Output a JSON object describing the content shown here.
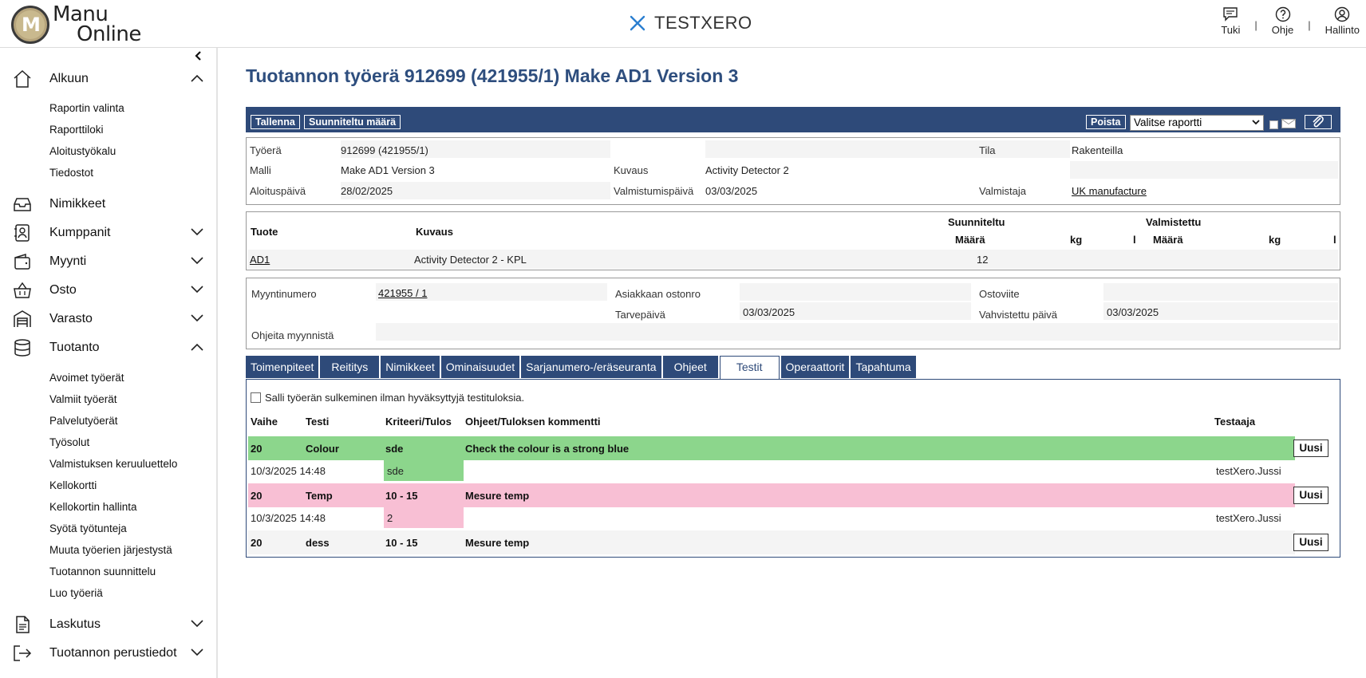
{
  "header": {
    "logo_line1": "Manu",
    "logo_line2": "Online",
    "brand": "TESTXERO",
    "actions": [
      {
        "label": "Tuki",
        "icon": "chat-icon"
      },
      {
        "label": "Ohje",
        "icon": "help-icon"
      },
      {
        "label": "Hallinto",
        "icon": "user-icon"
      }
    ],
    "separator": "|"
  },
  "sidebar": {
    "collapse_glyph": "‹",
    "sections": [
      {
        "label": "Alkuun",
        "icon": "home-icon",
        "expanded": true,
        "items": [
          "Raportin valinta",
          "Raporttiloki",
          "Aloitustyökalu",
          "Tiedostot"
        ]
      },
      {
        "label": "Nimikkeet",
        "icon": "inbox-icon",
        "expanded": null,
        "items": []
      },
      {
        "label": "Kumppanit",
        "icon": "contacts-icon",
        "expanded": false,
        "items": []
      },
      {
        "label": "Myynti",
        "icon": "wallet-icon",
        "expanded": false,
        "items": []
      },
      {
        "label": "Osto",
        "icon": "basket-icon",
        "expanded": false,
        "items": []
      },
      {
        "label": "Varasto",
        "icon": "warehouse-icon",
        "expanded": false,
        "items": []
      },
      {
        "label": "Tuotanto",
        "icon": "database-icon",
        "expanded": true,
        "items": [
          "Avoimet työerät",
          "Valmiit työerät",
          "Palvelutyöerät",
          "Työsolut",
          "Valmistuksen keruuluettelo",
          "Kellokortti",
          "Kellokortin hallinta",
          "Syötä työtunteja",
          "Muuta työerien järjestystä",
          "Tuotannon suunnittelu",
          "Luo työeriä"
        ]
      },
      {
        "label": "Laskutus",
        "icon": "document-icon",
        "expanded": false,
        "items": []
      },
      {
        "label": "Tuotannon perustiedot",
        "icon": "exit-icon",
        "expanded": false,
        "items": []
      }
    ]
  },
  "page": {
    "title": "Tuotannon työerä 912699 (421955/1) Make AD1 Version 3"
  },
  "toolbar": {
    "save_label": "Tallenna",
    "planned_qty_label": "Suunniteltu määrä",
    "delete_label": "Poista",
    "report_select": "Valitse raportti"
  },
  "info": {
    "tyoera_label": "Työerä",
    "tyoera_value": "912699 (421955/1)",
    "tila_label": "Tila",
    "tila_value": "Rakenteilla",
    "malli_label": "Malli",
    "malli_value": "Make AD1 Version 3",
    "kuvaus_label": "Kuvaus",
    "kuvaus_value": "Activity Detector 2",
    "aloitus_label": "Aloituspäivä",
    "aloitus_value": "28/02/2025",
    "valmistumis_label": "Valmistumispäivä",
    "valmistumis_value": "03/03/2025",
    "valmistaja_label": "Valmistaja",
    "valmistaja_value": "UK manufacture"
  },
  "products": {
    "headers": {
      "tuote": "Tuote",
      "kuvaus": "Kuvaus",
      "planned": "Suunniteltu",
      "produced": "Valmistettu",
      "maara": "Määrä",
      "kg": "kg",
      "l": "l"
    },
    "rows": [
      {
        "tuote": "AD1",
        "kuvaus": "Activity Detector 2 - KPL",
        "planned_qty": "12"
      }
    ]
  },
  "sales": {
    "myyntinumero_label": "Myyntinumero",
    "myyntinumero_value": "421955 / 1",
    "asiakkaan_label": "Asiakkaan ostonro",
    "asiakkaan_value": "",
    "ostoviite_label": "Ostoviite",
    "ostoviite_value": "",
    "tarvepaiva_label": "Tarvepäivä",
    "tarvepaiva_value": "03/03/2025",
    "vahvistettu_label": "Vahvistettu päivä",
    "vahvistettu_value": "03/03/2025",
    "ohjeita_label": "Ohjeita myynnistä",
    "ohjeita_value": ""
  },
  "tabs": [
    {
      "label": "Toimenpiteet",
      "active": false
    },
    {
      "label": "Reititys",
      "active": false
    },
    {
      "label": "Nimikkeet",
      "active": false
    },
    {
      "label": "Ominaisuudet",
      "active": false
    },
    {
      "label": "Sarjanumero-/eräseuranta",
      "active": false
    },
    {
      "label": "Ohjeet",
      "active": false
    },
    {
      "label": "Testit",
      "active": true
    },
    {
      "label": "Operaattorit",
      "active": false
    },
    {
      "label": "Tapahtuma",
      "active": false
    }
  ],
  "tests": {
    "allow_close_label": "Salli työerän sulkeminen ilman hyväksyttyjä testituloksia.",
    "headers": {
      "vaihe": "Vaihe",
      "testi": "Testi",
      "kriteeri": "Kriteeri/Tulos",
      "ohjeet": "Ohjeet/Tuloksen kommentti",
      "testaaja": "Testaaja"
    },
    "new_label": "Uusi",
    "rows": [
      {
        "vaihe": "20",
        "testi": "Colour",
        "kriteeri": "sde",
        "ohjeet": "Check the colour is a strong blue",
        "status": "pass",
        "result": {
          "time": "10/3/2025 14:48",
          "value": "sde",
          "tester": "testXero.Jussi"
        }
      },
      {
        "vaihe": "20",
        "testi": "Temp",
        "kriteeri": "10 - 15",
        "ohjeet": "Mesure temp",
        "status": "fail",
        "result": {
          "time": "10/3/2025 14:48",
          "value": "2",
          "tester": "testXero.Jussi"
        }
      },
      {
        "vaihe": "20",
        "testi": "dess",
        "kriteeri": "10 - 15",
        "ohjeet": "Mesure temp",
        "status": "none",
        "result": null
      }
    ]
  },
  "colors": {
    "primary": "#2e4a79",
    "title": "#2e4e7e",
    "pass": "#8cd68c",
    "fail": "#f8bfd4",
    "neutral": "#f4f4f4"
  }
}
